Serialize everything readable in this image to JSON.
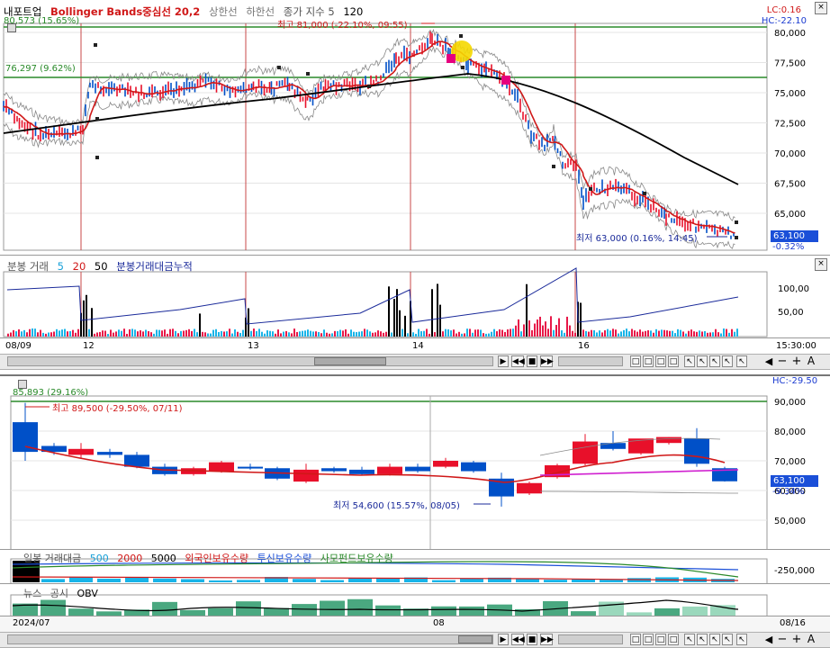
{
  "top_chart": {
    "legend_prefix": "내포트업",
    "legend_title": "Bollinger Bands중심선 20,2",
    "legend_upper": "상한선",
    "legend_lower": "하한선",
    "legend_ma": "종가 지수 5",
    "legend_ma2": "120",
    "lc_label": "LC:0.16",
    "hc_label": "HC:-22.10",
    "upper_line_label": "80,573 (15.65%)",
    "mid_line_label": "76,297 (9.62%)",
    "high_annot": "최고 81,000 (-22.10%, 09:55)",
    "low_annot": "최저 63,000 (0.16%, 14:45)",
    "price_tag": "63,100",
    "price_pct": "-0.32%",
    "y_ticks": [
      "80,000",
      "77,500",
      "75,000",
      "72,500",
      "70,000",
      "67,500",
      "65,000"
    ],
    "colors": {
      "up": "#e8102a",
      "down": "#0050c8",
      "ma": "#d01818",
      "long": "#000000",
      "band": "#888888",
      "hline": "#2a8a2a"
    }
  },
  "volume_panel": {
    "legend_label": "분봉 거래",
    "ma5": "5",
    "ma20": "20",
    "ma50": "50",
    "cum_label": "분봉거래대금누적",
    "y_ticks": [
      "100,00",
      "50,00"
    ]
  },
  "top_xaxis": {
    "labels": [
      "08/09",
      "12",
      "13",
      "14",
      "16"
    ],
    "time_label": "15:30:00"
  },
  "bottom_chart": {
    "hc_label": "HC:-29.50",
    "hline_label": "85,893 (29.16%)",
    "high_annot": "최고 89,500 (-29.50%, 07/11)",
    "low_annot": "최저 54,600 (15.57%, 08/05)",
    "price_tag": "63,100",
    "price_pct": "-9.34%",
    "y_ticks": [
      "90,000",
      "80,000",
      "70,000",
      "60,000",
      "50,000"
    ]
  },
  "sub_panel1": {
    "label_volume": "일봉 거래대금",
    "v500": "500",
    "v2000": "2000",
    "v5000": "5000",
    "foreign": "외국인보유수량",
    "trust": "투신보유수량",
    "private": "사모펀드보유수량",
    "y_tick": "-250,000"
  },
  "sub_panel2": {
    "news": "뉴스",
    "disclosure": "공시",
    "obv": "OBV"
  },
  "bottom_xaxis": {
    "labels": [
      "2024/07",
      "08"
    ],
    "right_label": "08/16"
  },
  "controls": {
    "minus": "−",
    "plus": "+",
    "auto": "A"
  }
}
